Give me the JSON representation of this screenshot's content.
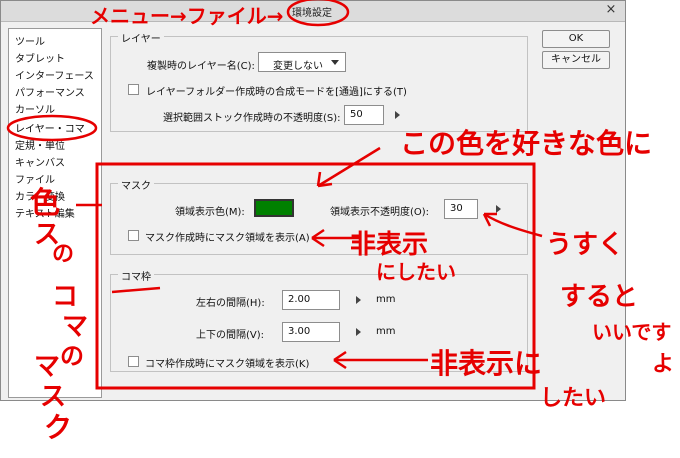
{
  "window": {
    "title": "環境設定",
    "close_glyph": "×"
  },
  "categories": [
    "ツール",
    "タブレット",
    "インターフェース",
    "パフォーマンス",
    "カーソル",
    "レイヤー・コマ",
    "定規・単位",
    "キャンバス",
    "ファイル",
    "カラー変換",
    "テキスト編集"
  ],
  "buttons": {
    "ok": "OK",
    "cancel": "キャンセル"
  },
  "layer_group": {
    "legend": "レイヤー",
    "duplicate_name_label": "複製時のレイヤー名(C):",
    "duplicate_name_value": "変更しない",
    "folder_blend_label": "レイヤーフォルダー作成時の合成モードを[通過]にする(T)",
    "selection_stock_label": "選択範囲ストック作成時の不透明度(S):",
    "selection_stock_value": "50"
  },
  "mask_group": {
    "legend": "マスク",
    "area_color_label": "領域表示色(M):",
    "area_color": "#008000",
    "area_opacity_label": "領域表示不透明度(O):",
    "area_opacity_value": "30",
    "show_area_label": "マスク作成時にマスク領域を表示(A)"
  },
  "frame_group": {
    "legend": "コマ枠",
    "horizontal_label": "左右の間隔(H):",
    "horizontal_value": "2.00",
    "vertical_label": "上下の間隔(V):",
    "vertical_value": "3.00",
    "unit": "mm",
    "show_mask_label": "コマ枠作成時にマスク領域を表示(K)"
  },
  "annotations": {
    "menu_path": "メニュー→ファイル→",
    "color_note": "この色を好きな色に",
    "hide_note_1a": "非表示",
    "hide_note_1b": "にしたい",
    "thin_note_1": "うすく",
    "thin_note_2": "すると",
    "thin_note_3": "いいです",
    "thin_note_4": "よ",
    "vertical_note_1": "色",
    "vertical_note_2": "ス",
    "vertical_note_3": "の",
    "vertical_note_4": "コ",
    "vertical_note_5": "マ",
    "vertical_note_6": "の",
    "vertical_note_7": "マ",
    "vertical_note_8": "ス",
    "vertical_note_9": "ク",
    "hide_note_2a": "非表示に",
    "hide_note_2b": "したい",
    "red": "#e60000"
  }
}
